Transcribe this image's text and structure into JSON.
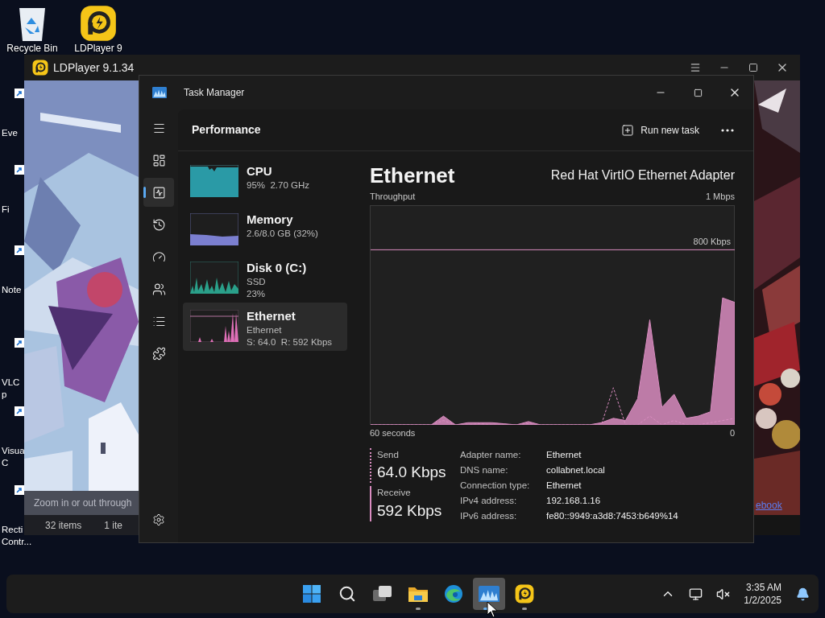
{
  "desktop_icons": [
    {
      "label": "Recycle Bin",
      "kind": "recycle-bin"
    },
    {
      "label": "LDPlayer 9",
      "kind": "ldplayer"
    }
  ],
  "desktop_shortcuts": [
    {
      "lines": [
        "Eve"
      ]
    },
    {
      "lines": [
        "Fi"
      ]
    },
    {
      "lines": [
        "Note"
      ]
    },
    {
      "lines": [
        "VLC",
        "p"
      ]
    },
    {
      "lines": [
        "Visua",
        "C"
      ]
    },
    {
      "lines": [
        "Recti",
        "Contr..."
      ]
    }
  ],
  "ldplayer_window": {
    "title": "LDPlayer 9.1.34",
    "hint": "Zoom in or out through",
    "status_items": [
      "32 items",
      "1 ite"
    ],
    "link": "ebook"
  },
  "task_manager": {
    "title": "Task Manager",
    "page_title": "Performance",
    "run_new_task": "Run new task",
    "nav": [
      {
        "kind": "processes",
        "selected": false
      },
      {
        "kind": "performance",
        "selected": true
      },
      {
        "kind": "history",
        "selected": false
      },
      {
        "kind": "startup",
        "selected": false
      },
      {
        "kind": "users",
        "selected": false
      },
      {
        "kind": "details",
        "selected": false
      },
      {
        "kind": "services",
        "selected": false
      }
    ],
    "resources": [
      {
        "kind": "cpu",
        "name": "CPU",
        "lines": [
          "95%  2.70 GHz"
        ],
        "selected": false
      },
      {
        "kind": "memory",
        "name": "Memory",
        "lines": [
          "2.6/8.0 GB (32%)"
        ],
        "selected": false
      },
      {
        "kind": "disk",
        "name": "Disk 0 (C:)",
        "lines": [
          "SSD",
          "23%"
        ],
        "selected": false
      },
      {
        "kind": "ethernet",
        "name": "Ethernet",
        "lines": [
          "Ethernet",
          "S: 64.0  R: 592 Kbps"
        ],
        "selected": true
      }
    ],
    "detail": {
      "title": "Ethernet",
      "adapter": "Red Hat VirtIO Ethernet Adapter",
      "graph": {
        "caption": "Throughput",
        "scale_max": "1 Mbps",
        "threshold": "800 Kbps",
        "x_start": "60 seconds",
        "x_end": "0"
      },
      "send": {
        "label": "Send",
        "value": "64.0 Kbps"
      },
      "receive": {
        "label": "Receive",
        "value": "592 Kbps"
      },
      "properties": [
        {
          "label": "Adapter name:",
          "value": "Ethernet"
        },
        {
          "label": "DNS name:",
          "value": "collabnet.local"
        },
        {
          "label": "Connection type:",
          "value": "Ethernet"
        },
        {
          "label": "IPv4 address:",
          "value": "192.168.1.16"
        },
        {
          "label": "IPv6 address:",
          "value": "fe80::9949:a3d8:7453:b649%14"
        }
      ]
    }
  },
  "taskbar": {
    "apps": [
      {
        "kind": "start",
        "running": false,
        "selected": false
      },
      {
        "kind": "search",
        "running": false,
        "selected": false
      },
      {
        "kind": "task-view",
        "running": false,
        "selected": false
      },
      {
        "kind": "file-explorer",
        "running": true,
        "selected": false
      },
      {
        "kind": "browser",
        "running": false,
        "selected": false
      },
      {
        "kind": "task-manager",
        "running": true,
        "selected": true
      },
      {
        "kind": "ldplayer",
        "running": true,
        "selected": false
      }
    ],
    "time": "3:35 AM",
    "date": "1/2/2025"
  }
}
